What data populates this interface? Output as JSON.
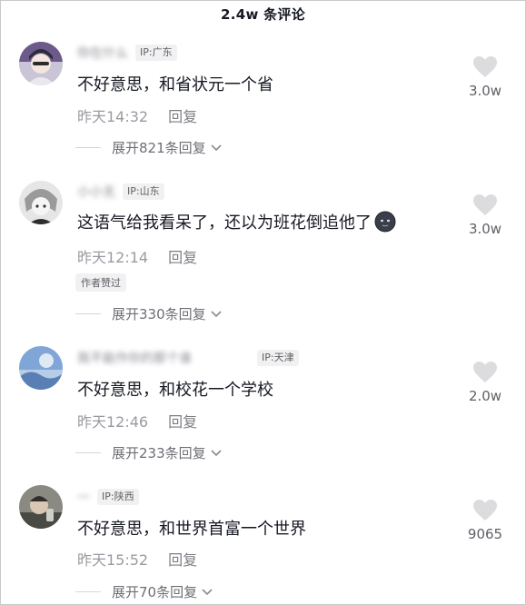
{
  "header": {
    "title": "2.4w 条评论"
  },
  "comments": [
    {
      "username": "你在什么",
      "ip": "IP:广东",
      "text": "不好意思，和省状元一个省",
      "time": "昨天14:32",
      "reply": "回复",
      "expand": "展开821条回复",
      "likes": "3.0w"
    },
    {
      "username": "小小无",
      "ip": "IP:山东",
      "text": "这语气给我看呆了，还以为班花倒追他了",
      "emoji": "dark-smirk-emoji",
      "time": "昨天12:14",
      "reply": "回复",
      "badge": "作者赞过",
      "expand": "展开330条回复",
      "likes": "3.0w"
    },
    {
      "username": "我不能作你的那个谁",
      "ip": "IP:天津",
      "text": "不好意思，和校花一个学校",
      "time": "昨天12:46",
      "reply": "回复",
      "expand": "展开233条回复",
      "likes": "2.0w"
    },
    {
      "username": "一",
      "ip": "IP:陕西",
      "text": "不好意思，和世界首富一个世界",
      "time": "昨天15:52",
      "reply": "回复",
      "expand": "展开70条回复",
      "likes": "9065"
    }
  ],
  "colors": {
    "text_primary": "#161823",
    "text_secondary": "#9a9ba1",
    "heart": "#dcdcdf"
  }
}
